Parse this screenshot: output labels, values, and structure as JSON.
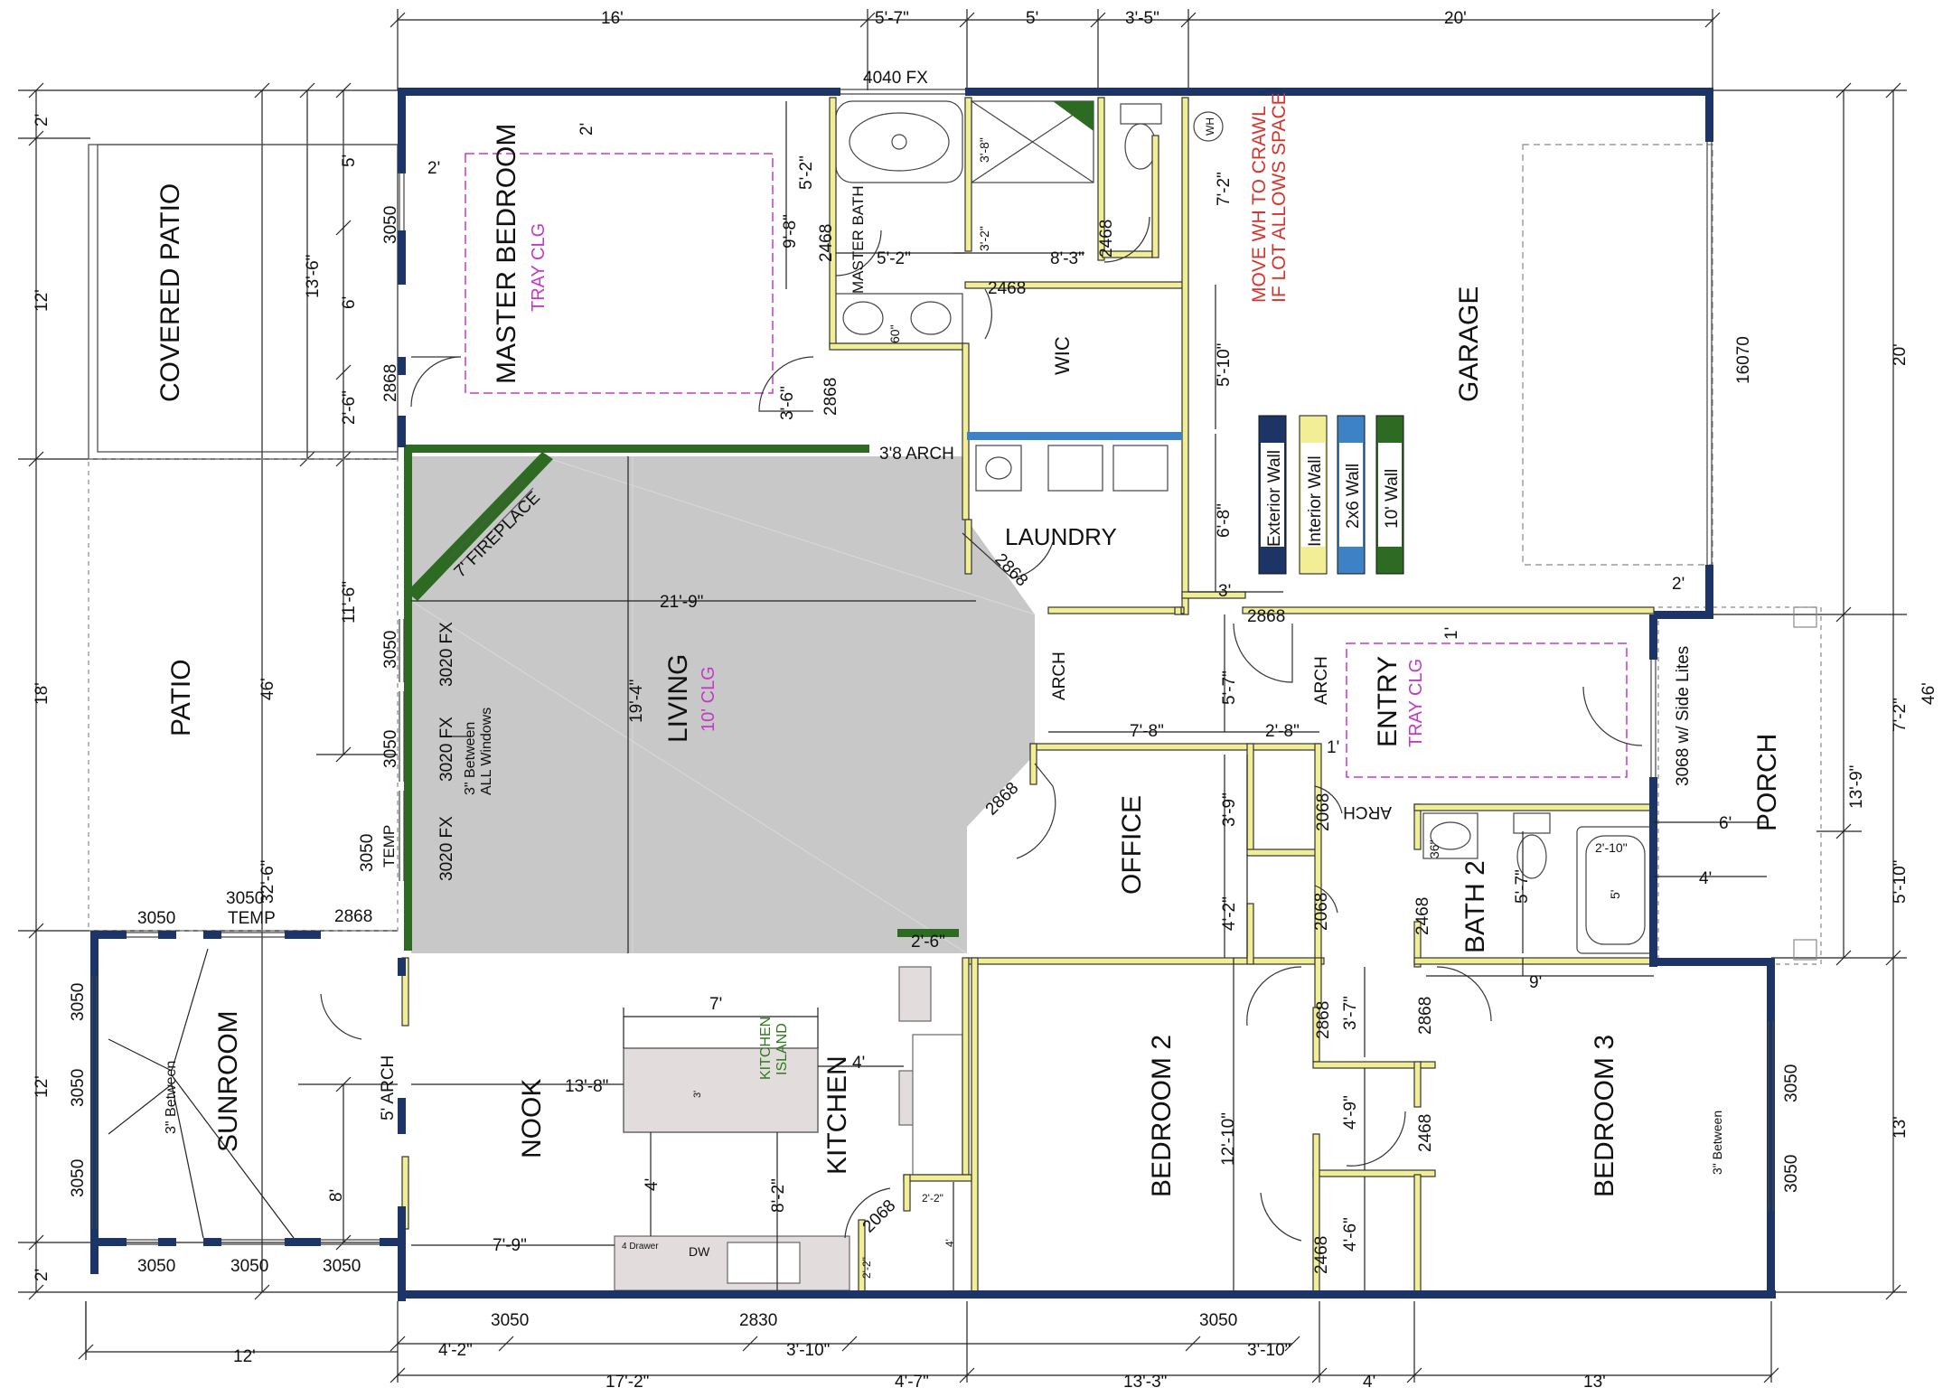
{
  "colors": {
    "exterior": "#1c3566",
    "interior": "#f2ee96",
    "wall2x6": "#3d82c4",
    "wall10": "#2e6b22",
    "accent_pink": "#c23ac8",
    "note_red": "#d8332a",
    "living_fill": "#c8c8c8",
    "island_fill": "#e2dcdc"
  },
  "rooms": {
    "covered_patio": "COVERED PATIO",
    "patio": "PATIO",
    "sunroom": "SUNROOM",
    "master_bedroom": "MASTER BEDROOM",
    "master_bath": "MASTER BATH",
    "wic": "WIC",
    "laundry": "LAUNDRY",
    "garage": "GARAGE",
    "living": "LIVING",
    "entry": "ENTRY",
    "porch": "PORCH",
    "office": "OFFICE",
    "bath2": "BATH 2",
    "nook": "NOOK",
    "kitchen": "KITCHEN",
    "bedroom2": "BEDROOM 2",
    "bedroom3": "BEDROOM 3"
  },
  "ceilings": {
    "master": "TRAY CLG",
    "entry": "TRAY CLG",
    "living": "10' CLG"
  },
  "notes": {
    "wh_line1": "MOVE WH TO CRAWL",
    "wh_line2": "IF LOT ALLOWS SPACE",
    "wh": "WH",
    "fireplace": "7' FIREPLACE",
    "kitchen_island_1": "KITCHEN",
    "kitchen_island_2": "ISLAND",
    "between_windows_1": "3\" Between",
    "between_windows_2": "ALL Windows",
    "sunroom_between": "3\" Between",
    "bed3_between": "3\" Between",
    "door_side_lites": "3068 w/ Side Lites",
    "arch_38": "3'8 ARCH",
    "arch_5": "5' ARCH",
    "arch": "ARCH",
    "dw": "DW",
    "drawer": "4 Drawer"
  },
  "legend": [
    "Exterior Wall",
    "Interior Wall",
    "2x6 Wall",
    "10' Wall"
  ],
  "dims_top": [
    "16'",
    "5'-7\"",
    "5'",
    "3'-5\"",
    "20'"
  ],
  "dims_bottom": [
    "4'-2\"",
    "3'-10\"",
    "3'-10\"",
    "17'-2\"",
    "4'-7\"",
    "13'-3\"",
    "4'",
    "13'",
    "12'"
  ],
  "dims_left": [
    "2'",
    "12'",
    "18'",
    "12'",
    "2'",
    "46'",
    "13'-6\"",
    "11'-6\"",
    "32'-6\"",
    "5'",
    "6'",
    "2'-6\"",
    "8'"
  ],
  "dims_right": [
    "20'",
    "7'-2\"",
    "5'-10\"",
    "13'",
    "46'",
    "13'-9\""
  ],
  "windows": {
    "top": "4040 FX",
    "w3050": "3050",
    "w3050temp": "3050",
    "temp": "TEMP",
    "w3020fx": "3020 FX",
    "garage_door": "16070",
    "w2830": "2830"
  },
  "doors": {
    "d2868": "2868",
    "d2468": "2468",
    "d2068": "2068"
  },
  "interior_dims": {
    "d_2": "2'",
    "d_5_2": "5'-2\"",
    "d_9_8": "9'-8\"",
    "d_8_3": "8'-3\"",
    "d_3_8": "3'-8\"",
    "d_3_2": "3'-2\"",
    "d_60": "60\"",
    "d_3_6": "3'-6\"",
    "d_7_2": "7'-2\"",
    "d_5_10": "5'-10\"",
    "d_6_8": "6'-8\"",
    "d_3": "3'",
    "d_21_9": "21'-9\"",
    "d_19_4": "19'-4\"",
    "d_7_8": "7'-8\"",
    "d_2_8": "2'-8\"",
    "d_5_7": "5'-7\"",
    "d_1": "1'",
    "d_3_9": "3'-9\"",
    "d_4_2": "4'-2\"",
    "d_2_6": "2'-6\"",
    "d_36": "36\"",
    "d_2_10": "2'-10\"",
    "d_5": "5'",
    "d_6": "6'",
    "d_4": "4'",
    "d_9": "9'",
    "d_3_7": "3'-7\"",
    "d_7": "7'",
    "d_13_8": "13'-8\"",
    "d_3in": "3'",
    "d_4k": "4'",
    "d_4n": "4'",
    "d_8_2": "8'-2\"",
    "d_7_9": "7'-9\"",
    "d_2_2": "2'-2\"",
    "d_2_2b": "2'-2\"",
    "d_12_10": "12'-10\"",
    "d_4_9": "4'-9\"",
    "d_4_6": "4'-6\"",
    "d_12s": "12'",
    "d_4p": "4'"
  }
}
